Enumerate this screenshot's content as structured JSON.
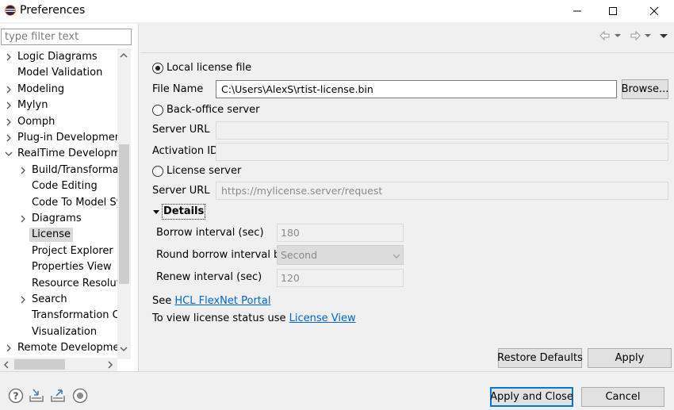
{
  "window": {
    "title": "Preferences",
    "accent_color": "#0078d7",
    "link_color": "#0066cc"
  },
  "filter": {
    "placeholder": "type filter text",
    "value": ""
  },
  "tree": {
    "items": [
      {
        "label": "Logic Diagrams",
        "level": 0,
        "expander": "collapsed"
      },
      {
        "label": "Model Validation",
        "level": 0,
        "expander": "none"
      },
      {
        "label": "Modeling",
        "level": 0,
        "expander": "collapsed"
      },
      {
        "label": "Mylyn",
        "level": 0,
        "expander": "collapsed"
      },
      {
        "label": "Oomph",
        "level": 0,
        "expander": "collapsed"
      },
      {
        "label": "Plug-in Development",
        "level": 0,
        "expander": "collapsed"
      },
      {
        "label": "RealTime Developme",
        "level": 0,
        "expander": "expanded"
      },
      {
        "label": "Build/Transformati",
        "level": 1,
        "expander": "collapsed"
      },
      {
        "label": "Code Editing",
        "level": 1,
        "expander": "none"
      },
      {
        "label": "Code To Model Sy",
        "level": 1,
        "expander": "none"
      },
      {
        "label": "Diagrams",
        "level": 1,
        "expander": "collapsed"
      },
      {
        "label": "License",
        "level": 1,
        "expander": "none",
        "selected": true
      },
      {
        "label": "Project Explorer",
        "level": 1,
        "expander": "none"
      },
      {
        "label": "Properties View",
        "level": 1,
        "expander": "none"
      },
      {
        "label": "Resource Resolutio",
        "level": 1,
        "expander": "none"
      },
      {
        "label": "Search",
        "level": 1,
        "expander": "collapsed"
      },
      {
        "label": "Transformation Co",
        "level": 1,
        "expander": "none"
      },
      {
        "label": "Visualization",
        "level": 1,
        "expander": "none"
      },
      {
        "label": "Remote Developmen",
        "level": 0,
        "expander": "collapsed"
      }
    ]
  },
  "license": {
    "local": {
      "radio_label": "Local license file",
      "selected": true,
      "file_name_label": "File Name",
      "file_name_value": "C:\\Users\\AlexS\\rtist-license.bin",
      "browse_label": "Browse..."
    },
    "backoffice": {
      "radio_label": "Back-office server",
      "selected": false,
      "server_url_label": "Server URL",
      "server_url_value": "",
      "activation_id_label": "Activation ID",
      "activation_id_value": ""
    },
    "license_server": {
      "radio_label": "License server",
      "selected": false,
      "server_url_label": "Server URL",
      "server_url_placeholder": "https://mylicense.server/request"
    },
    "details": {
      "label": "Details",
      "expanded": true,
      "borrow_interval_label": "Borrow interval (sec)",
      "borrow_interval_value": "180",
      "round_by_label": "Round borrow interval by",
      "round_by_value": "Second",
      "renew_interval_label": "Renew interval (sec)",
      "renew_interval_value": "120"
    },
    "see_prefix": "See",
    "portal_link": "HCL FlexNet Portal",
    "view_prefix": "To view license status use",
    "view_link": "License View"
  },
  "buttons": {
    "restore_defaults": "Restore Defaults",
    "apply": "Apply",
    "apply_and_close": "Apply and Close",
    "cancel": "Cancel"
  },
  "bottom_icons": [
    "help-icon",
    "import-icon",
    "export-icon",
    "record-icon"
  ]
}
